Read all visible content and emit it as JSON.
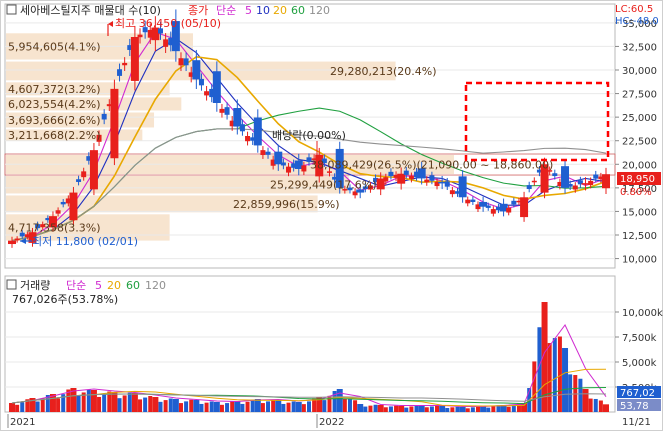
{
  "price_panel": {
    "title": "세아베스틸지주 매물대 수(10)",
    "legend": {
      "price_label": "종가",
      "ma_label": "단순",
      "periods": [
        "5",
        "10",
        "20",
        "60",
        "120"
      ]
    },
    "axis_ticks": [
      "35,000",
      "32,500",
      "30,000",
      "27,500",
      "25,000",
      "22,500",
      "20,000",
      "17,500",
      "15,000",
      "12,500",
      "10,000"
    ],
    "lc_label": "LC:60.5",
    "hc_label": "HC:-48.0",
    "high_marker": "최고 36,450 (05/10)",
    "low_marker": "최저 11,800 (02/01)",
    "current_price": "18,950",
    "current_pct": "0.80%",
    "dividend_label": "배당락(0.00%)",
    "volume_profile": [
      {
        "label": "5,954,605(4.1%)"
      },
      {
        "label": "29,280,213(20.4%)"
      },
      {
        "label": "4,607,372(3.2%)"
      },
      {
        "label": "6,023,554(4.2%)"
      },
      {
        "label": "3,693,666(2.6%)"
      },
      {
        "label": "3,211,668(2.2%)"
      },
      {
        "label": "38,089,429(26.5%)(21,090.00 ~ 18,860.00)"
      },
      {
        "label": "25,299,449(17.6%)"
      },
      {
        "label": "22,859,996(15.9%)"
      },
      {
        "label": "4,717,358(3.3%)"
      }
    ]
  },
  "volume_panel": {
    "title": "거래량",
    "ma_label": "단순",
    "periods": [
      "5",
      "20",
      "60",
      "120"
    ],
    "last_label": "767,026주(53.78%)",
    "axis_ticks": [
      "10,000k",
      "7,500k",
      "5,000k",
      "2,500k"
    ],
    "current_volume": "767,02",
    "current_pct": "53,78"
  },
  "x_axis": {
    "labels": [
      "2021",
      "2022",
      "11/21"
    ]
  },
  "colors": {
    "up": "#e8201c",
    "down": "#1f5fd0",
    "ma5": "#d02ad0",
    "ma10": "#2030c0",
    "ma20": "#e8a800",
    "ma60": "#20a040",
    "ma120": "#909090",
    "volume_profile_band": "#f7e4cf",
    "highlight_box": "#ff0000"
  },
  "chart_data": [
    {
      "type": "candlestick",
      "title": "세아베스틸지주 매물대 수(10)",
      "ylim": [
        9000,
        37000
      ],
      "x_labels": [
        "2021",
        "2022",
        "11/21"
      ],
      "approx_close": [
        11900,
        12800,
        14500,
        17000,
        21500,
        28000,
        33500,
        34500,
        32000,
        29000,
        26500,
        24000,
        22000,
        20000,
        19500,
        21000,
        17500,
        17000,
        18500,
        19000,
        18500,
        18000,
        16500,
        15500,
        15000,
        16500,
        20000,
        17500,
        18000,
        18950
      ],
      "high": 36450,
      "low": 11800,
      "moving_averages": [
        "5",
        "10",
        "20",
        "60",
        "120"
      ]
    },
    {
      "type": "bar",
      "title": "거래량",
      "ylim": [
        0,
        12000000
      ],
      "approx_volume": [
        900000,
        1400000,
        1800000,
        2400000,
        2200000,
        2000000,
        1900000,
        1500000,
        1300000,
        1200000,
        1000000,
        1100000,
        1300000,
        1200000,
        1000000,
        1500000,
        2300000,
        800000,
        700000,
        600000,
        700000,
        600000,
        500000,
        600000,
        700000,
        900000,
        11000000,
        6400000,
        2300000,
        767026
      ]
    }
  ]
}
